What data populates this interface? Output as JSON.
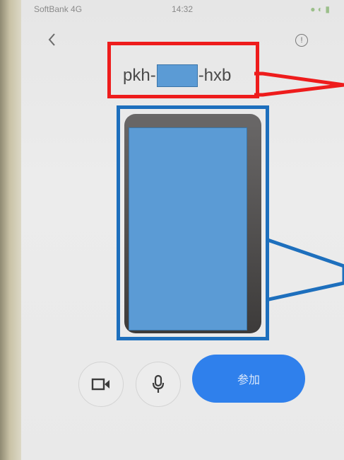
{
  "status_bar": {
    "carrier": "SoftBank 4G",
    "time": "14:32"
  },
  "meeting_code": {
    "prefix": "pkh-",
    "suffix": "-hxb"
  },
  "controls": {
    "video_icon": "video-camera-icon",
    "mic_icon": "microphone-icon",
    "join_label": "参加"
  },
  "annotations": {
    "code_highlight_color": "#ee1c1c",
    "preview_highlight_color": "#1d6fbd",
    "redaction_color": "#5b9bd5"
  }
}
